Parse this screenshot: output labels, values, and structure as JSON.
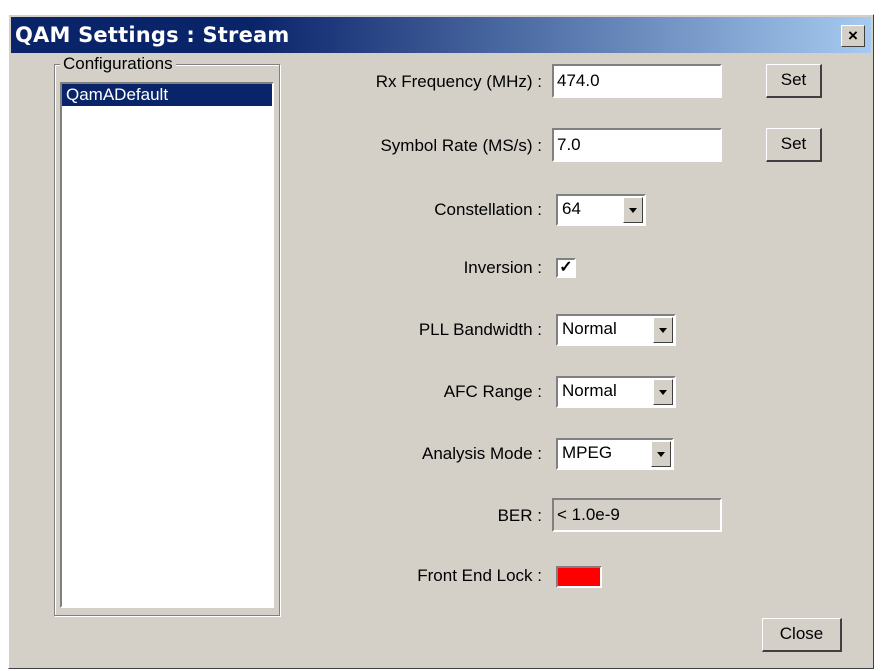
{
  "window": {
    "title": "QAM Settings : Stream",
    "close_glyph": "×"
  },
  "configurations": {
    "legend": "Configurations",
    "items": [
      "QamADefault"
    ]
  },
  "fields": {
    "rx_frequency": {
      "label": "Rx Frequency (MHz) :",
      "value": "474.0",
      "set_label": "Set"
    },
    "symbol_rate": {
      "label": "Symbol Rate (MS/s) :",
      "value": "7.0",
      "set_label": "Set"
    },
    "constellation": {
      "label": "Constellation :",
      "value": "64"
    },
    "inversion": {
      "label": "Inversion :",
      "checked": true,
      "check_glyph": "✓"
    },
    "pll_bandwidth": {
      "label": "PLL Bandwidth :",
      "value": "Normal"
    },
    "afc_range": {
      "label": "AFC Range :",
      "value": "Normal"
    },
    "analysis_mode": {
      "label": "Analysis Mode :",
      "value": "MPEG"
    },
    "ber": {
      "label": "BER :",
      "value": "< 1.0e-9"
    },
    "front_end_lock": {
      "label": "Front End Lock :",
      "status_color": "#ff0000"
    }
  },
  "buttons": {
    "close_label": "Close"
  },
  "colors": {
    "titlebar_start": "#0a246a",
    "titlebar_end": "#a6caf0",
    "dialog_bg": "#d4d0c8"
  }
}
